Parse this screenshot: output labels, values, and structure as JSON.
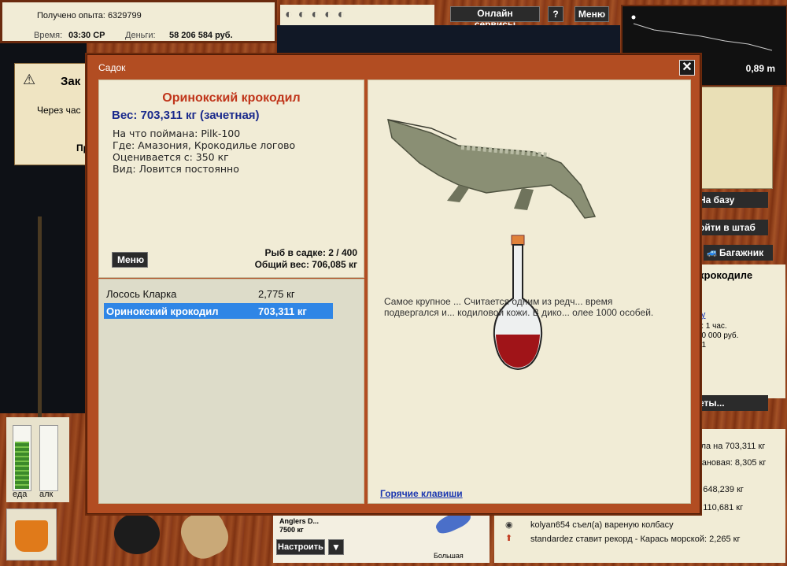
{
  "stats": {
    "exp_label": "Получено опыта:",
    "exp_value": "6329799",
    "time_label": "Время:",
    "time_value": "03:30 СР",
    "money_label": "Деньги:",
    "money_value": "58 206 584 руб."
  },
  "topbar": {
    "online_services": "Онлайн сервисы",
    "help": "?",
    "menu": "Меню"
  },
  "depth": {
    "value": "0,89 m"
  },
  "quest_note": {
    "title": "Зак",
    "line1": "Через час",
    "line2": "Пр"
  },
  "right_panel": {
    "to_base": "На базу",
    "to_hq": "ойти в штаб",
    "trunk": "Багажник",
    "location": "крокодиле",
    "link": "ку",
    "line1": "ь: 1 час.",
    "line2": "50 000 руб.",
    "line3": "21",
    "more": "еты..."
  },
  "meters": {
    "food": "еда",
    "alc": "алк"
  },
  "lure": {
    "name": "Anglers D...",
    "weight": "7500 кг",
    "configure": "Настроить",
    "size_label": "Большая"
  },
  "chat": {
    "lines": [
      "дила на 703,311 кг",
      "ймановая: 8,305 кг",
      "на 648,239 кг",
      "на 110,681 кг",
      "kolyan654 съел(а) вареную колбасу",
      "standardez ставит рекорд - Карась морской: 2,265 кг"
    ]
  },
  "modal": {
    "title": "Садок",
    "close": "✕",
    "fish": {
      "name": "Оринокский крокодил",
      "weight": "Вес: 703,311 кг (зачетная)",
      "caught_on": "На что поймана: Pilk-100",
      "where": "Где: Амазония, Крокодилье логово",
      "valued_from": "Оценивается с: 350 кг",
      "type": "Вид: Ловится постоянно"
    },
    "menu_button": "Меню",
    "fish_count": "Рыб в садке: 2 / 400",
    "total_weight": "Общий вес: 706,085 кг",
    "catch_list": [
      {
        "name": "Лосось Кларка",
        "weight": "2,775 кг"
      },
      {
        "name": "Оринокский крокодил",
        "weight": "703,311 кг"
      }
    ],
    "description": "Самое крупное ... Считается одним из редч... время подвергался и... кодиловой кожи. В дико... олее 1000 особей.",
    "hotkeys": "Горячие клавиши"
  }
}
